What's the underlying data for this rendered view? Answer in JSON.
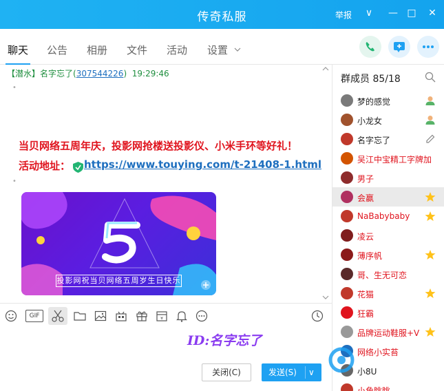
{
  "window": {
    "title": "传奇私服",
    "report_label": "举报",
    "controls": {
      "dropdown": "∨",
      "minimize": "—",
      "maximize": "□",
      "close": "✕"
    }
  },
  "tabs": [
    {
      "label": "聊天",
      "active": true
    },
    {
      "label": "公告"
    },
    {
      "label": "相册"
    },
    {
      "label": "文件"
    },
    {
      "label": "活动"
    },
    {
      "label": "设置",
      "has_dropdown": true
    }
  ],
  "top_actions": [
    "phone-icon",
    "screen-share-icon",
    "more-icon"
  ],
  "chat": {
    "message": {
      "role_tag": "【潜水】",
      "sender": "名字忘了",
      "qq_open": "(",
      "qq": "307544226",
      "qq_close": ")",
      "time": "19:29:46"
    },
    "announcement_line1": "当贝网络五周年庆，投影网抢楼送投影仪、小米手环等好礼！",
    "announcement_line2_prefix": "活动地址：",
    "announcement_link": "https://www.touying.com/t-21408-1.html",
    "bullet": "•",
    "banner": {
      "big_number": "5",
      "caption": "投影网祝当贝网络五周岁生日快乐"
    }
  },
  "toolbar": {
    "icons": [
      "emoji-icon",
      "gif-icon",
      "scissors-icon",
      "folder-icon",
      "image-icon",
      "gift-box-icon",
      "present-icon",
      "calendar-icon",
      "bell-icon",
      "more-dots-icon",
      "history-icon"
    ],
    "gif_label": "GIF"
  },
  "input": {
    "text": "ID:名字忘了"
  },
  "buttons": {
    "close": "关闭(C)",
    "send": "发送(S)",
    "send_arrow": "∨"
  },
  "members": {
    "title": "群成员 85/18",
    "list": [
      {
        "name": "梦的感觉",
        "color": "#222222",
        "role": "admin"
      },
      {
        "name": "小龙女",
        "color": "#222222",
        "role": "admin"
      },
      {
        "name": "名字忘了",
        "color": "#222222",
        "role": "edit"
      },
      {
        "name": "吴江中宝精工字牌加",
        "color": "#e0141e",
        "role": ""
      },
      {
        "name": "男子",
        "color": "#e0141e",
        "role": ""
      },
      {
        "name": "会赢",
        "color": "#e0141e",
        "role": "star",
        "highlight": true
      },
      {
        "name": "NaBabybaby",
        "color": "#e0141e",
        "role": "star"
      },
      {
        "name": "凌云",
        "color": "#e0141e",
        "role": ""
      },
      {
        "name": "薄序帆",
        "color": "#e0141e",
        "role": "star"
      },
      {
        "name": "哥、生无可恋",
        "color": "#e0141e",
        "role": ""
      },
      {
        "name": "花猫",
        "color": "#e0141e",
        "role": "star"
      },
      {
        "name": "狂霸",
        "color": "#e0141e",
        "role": ""
      },
      {
        "name": "品牌运动鞋服+V",
        "color": "#e0141e",
        "role": "star"
      },
      {
        "name": "网络小实苔",
        "color": "#e0141e",
        "role": ""
      },
      {
        "name": "小8U",
        "color": "#222222",
        "role": ""
      },
      {
        "name": "小角眺眺",
        "color": "#e0141e",
        "role": ""
      }
    ]
  },
  "watermark": {
    "text": "投影网"
  }
}
